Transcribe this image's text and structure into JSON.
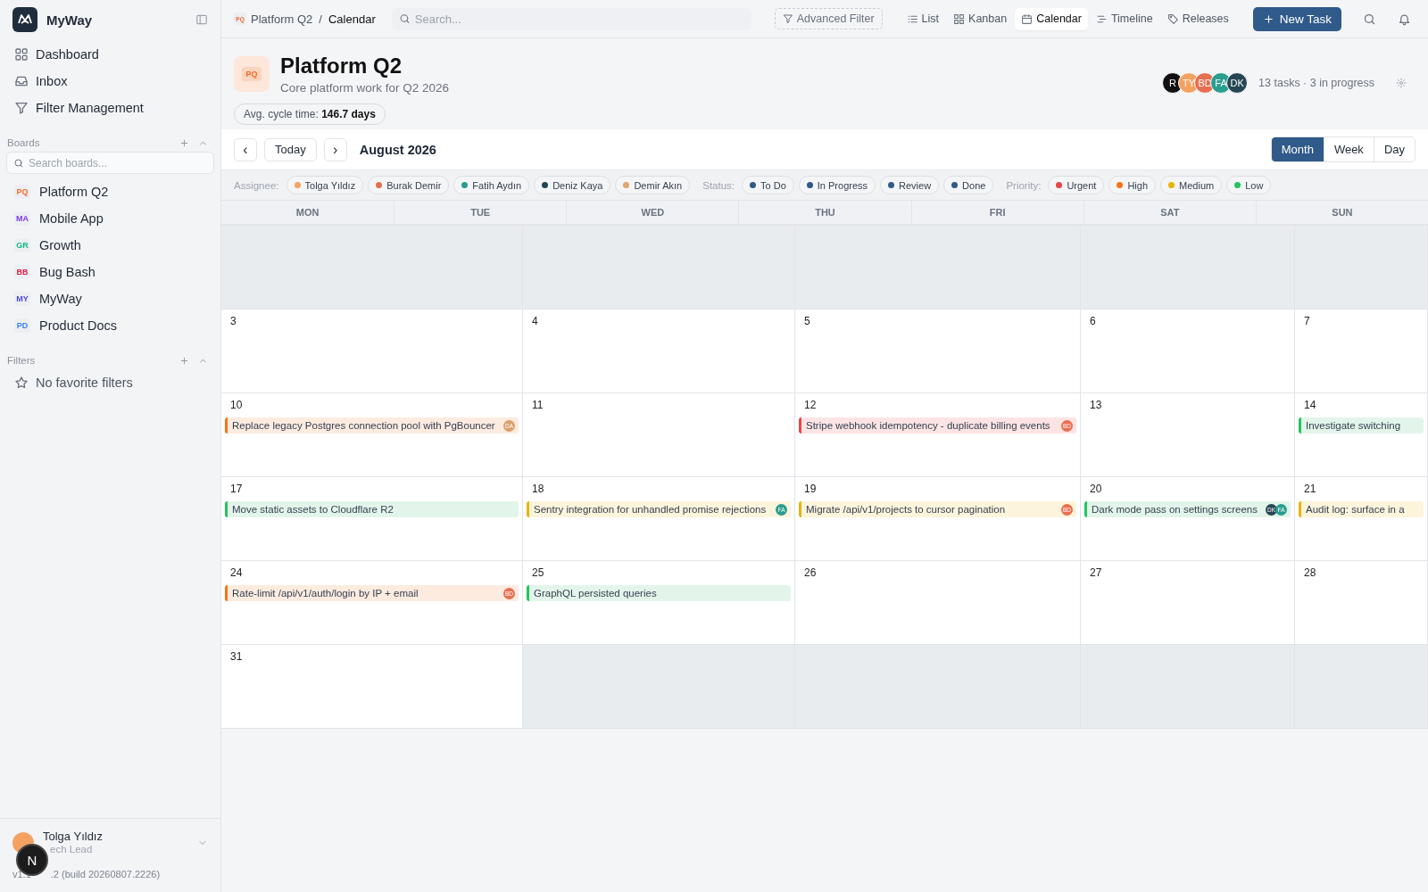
{
  "sidebar": {
    "app_name": "MyWay",
    "nav": [
      {
        "label": "Dashboard",
        "kind": "dashboard"
      },
      {
        "label": "Inbox",
        "kind": "inbox"
      },
      {
        "label": "Filter Management",
        "kind": "filter"
      }
    ],
    "boards_title": "Boards",
    "boards_search_placeholder": "Search boards...",
    "boards": [
      {
        "abbr": "PQ",
        "name": "Platform Q2",
        "color": "#f26b2a"
      },
      {
        "abbr": "MA",
        "name": "Mobile App",
        "color": "#7c3aed"
      },
      {
        "abbr": "GR",
        "name": "Growth",
        "color": "#10b981"
      },
      {
        "abbr": "BB",
        "name": "Bug Bash",
        "color": "#e11d48"
      },
      {
        "abbr": "MY",
        "name": "MyWay",
        "color": "#4f46e5"
      },
      {
        "abbr": "PD",
        "name": "Product Docs",
        "color": "#3b82f6"
      }
    ],
    "filters_title": "Filters",
    "filters_empty": "No favorite filters",
    "user": {
      "color": "#f4a261",
      "name": "Tolga Yıldız",
      "role": "ech Lead",
      "version_start": "v1.1",
      "version_end": ".2 (build 20260807.2226)"
    },
    "dev_badge": "N"
  },
  "topbar": {
    "breadcrumb": [
      {
        "abbr": "PQ",
        "label": "Platform Q2"
      },
      {
        "label": "Calendar"
      }
    ],
    "separator": "/",
    "search_placeholder": "Search...",
    "advanced_filter": "Advanced Filter",
    "views": [
      {
        "label": "List",
        "kind": "list",
        "selected": false
      },
      {
        "label": "Kanban",
        "kind": "kanban",
        "selected": false
      },
      {
        "label": "Calendar",
        "kind": "calendar",
        "selected": true
      },
      {
        "label": "Timeline",
        "kind": "timeline",
        "selected": false
      },
      {
        "label": "Releases",
        "kind": "releases",
        "selected": false
      }
    ],
    "new_task": "New Task"
  },
  "project": {
    "abbr": "PQ",
    "title": "Platform Q2",
    "description": "Core platform work for Q2 2026",
    "members": [
      {
        "initials": "R",
        "color": "#111111"
      },
      {
        "initials": "TY",
        "color": "#f4a261"
      },
      {
        "initials": "BD",
        "color": "#e76f51"
      },
      {
        "initials": "FA",
        "color": "#2a9d8f"
      },
      {
        "initials": "DK",
        "color": "#264653"
      }
    ],
    "summary": "13 tasks · 3 in progress",
    "cycle_time": "Avg. cycle time: **146.7 days**"
  },
  "calendar": {
    "prev": "‹",
    "today": "Today",
    "next": "›",
    "period": "August 2026",
    "modes": [
      {
        "label": "Month",
        "selected": true
      },
      {
        "label": "Week",
        "selected": false
      },
      {
        "label": "Day",
        "selected": false
      }
    ],
    "filter_groups": [
      {
        "label": "Assignee:",
        "chips": [
          {
            "label": "Tolga Yıldız",
            "color": "#f4a261"
          },
          {
            "label": "Burak Demir",
            "color": "#e76f51"
          },
          {
            "label": "Fatih Aydın",
            "color": "#2a9d8f"
          },
          {
            "label": "Deniz Kaya",
            "color": "#264653"
          },
          {
            "label": "Demir Akın",
            "color": "#e0a370"
          }
        ]
      },
      {
        "label": "Status:",
        "chips": [
          {
            "label": "To Do",
            "color": "#2f5a8a"
          },
          {
            "label": "In Progress",
            "color": "#2f5a8a"
          },
          {
            "label": "Review",
            "color": "#2f5a8a"
          },
          {
            "label": "Done",
            "color": "#2f5a8a"
          }
        ]
      },
      {
        "label": "Priority:",
        "chips": [
          {
            "label": "Urgent",
            "color": "#ef4444"
          },
          {
            "label": "High",
            "color": "#f97316"
          },
          {
            "label": "Medium",
            "color": "#eab308"
          },
          {
            "label": "Low",
            "color": "#22c55e"
          }
        ]
      }
    ],
    "weekdays": [
      "MON",
      "TUE",
      "WED",
      "THU",
      "FRI",
      "SAT",
      "SUN"
    ],
    "weeks": [
      {
        "cells": [
          {
            "outside": true
          },
          {
            "outside": true
          },
          {
            "outside": true
          },
          {
            "outside": true
          },
          {
            "outside": true
          }
        ]
      },
      {
        "cells": [
          {
            "day": "3",
            "outside": false
          },
          {
            "day": "4",
            "outside": false
          },
          {
            "day": "5",
            "outside": false
          },
          {
            "day": "6",
            "outside": false
          },
          {
            "day": "7",
            "outside": false
          }
        ]
      },
      {
        "cells": [
          {
            "day": "10",
            "outside": false,
            "events": [
              {
                "title": "Replace legacy Postgres connection pool with PgBouncer",
                "kind": "high",
                "assignees": [
                  {
                    "initials": "DA",
                    "color": "#d9a06b"
                  }
                ]
              }
            ]
          },
          {
            "day": "11",
            "outside": false
          },
          {
            "day": "12",
            "outside": false,
            "events": [
              {
                "title": "Stripe webhook idempotency - duplicate billing events",
                "kind": "urgent",
                "assignees": [
                  {
                    "initials": "BD",
                    "color": "#e76f51"
                  }
                ]
              }
            ]
          },
          {
            "day": "13",
            "outside": false
          },
          {
            "day": "14",
            "outside": false,
            "events": [
              {
                "title": "Investigate switching",
                "kind": "low"
              }
            ]
          }
        ]
      },
      {
        "cells": [
          {
            "day": "17",
            "outside": false,
            "events": [
              {
                "title": "Move static assets to Cloudflare R2",
                "kind": "low"
              }
            ]
          },
          {
            "day": "18",
            "outside": false,
            "events": [
              {
                "title": "Sentry integration for unhandled promise rejections",
                "kind": "medium",
                "assignees": [
                  {
                    "initials": "FA",
                    "color": "#2a9d8f"
                  }
                ]
              }
            ]
          },
          {
            "day": "19",
            "outside": false,
            "events": [
              {
                "title": "Migrate /api/v1/projects to cursor pagination",
                "kind": "medium",
                "assignees": [
                  {
                    "initials": "BD",
                    "color": "#e76f51"
                  }
                ]
              }
            ]
          },
          {
            "day": "20",
            "outside": false,
            "events": [
              {
                "title": "Dark mode pass on settings screens",
                "kind": "low",
                "assignees": [
                  {
                    "initials": "DK",
                    "color": "#264653"
                  },
                  {
                    "initials": "FA",
                    "color": "#2a9d8f"
                  }
                ]
              }
            ]
          },
          {
            "day": "21",
            "outside": false,
            "events": [
              {
                "title": "Audit log: surface in a",
                "kind": "medium"
              }
            ]
          }
        ]
      },
      {
        "cells": [
          {
            "day": "24",
            "outside": false,
            "events": [
              {
                "title": "Rate-limit /api/v1/auth/login by IP + email",
                "kind": "high",
                "assignees": [
                  {
                    "initials": "BD",
                    "color": "#e76f51"
                  }
                ]
              }
            ]
          },
          {
            "day": "25",
            "outside": false,
            "events": [
              {
                "title": "GraphQL persisted queries",
                "kind": "low"
              }
            ]
          },
          {
            "day": "26",
            "outside": false
          },
          {
            "day": "27",
            "outside": false
          },
          {
            "day": "28",
            "outside": false
          }
        ]
      },
      {
        "cells": [
          {
            "day": "31",
            "outside": false
          },
          {
            "outside": true
          },
          {
            "outside": true
          },
          {
            "outside": true
          },
          {
            "outside": true
          }
        ]
      }
    ]
  }
}
